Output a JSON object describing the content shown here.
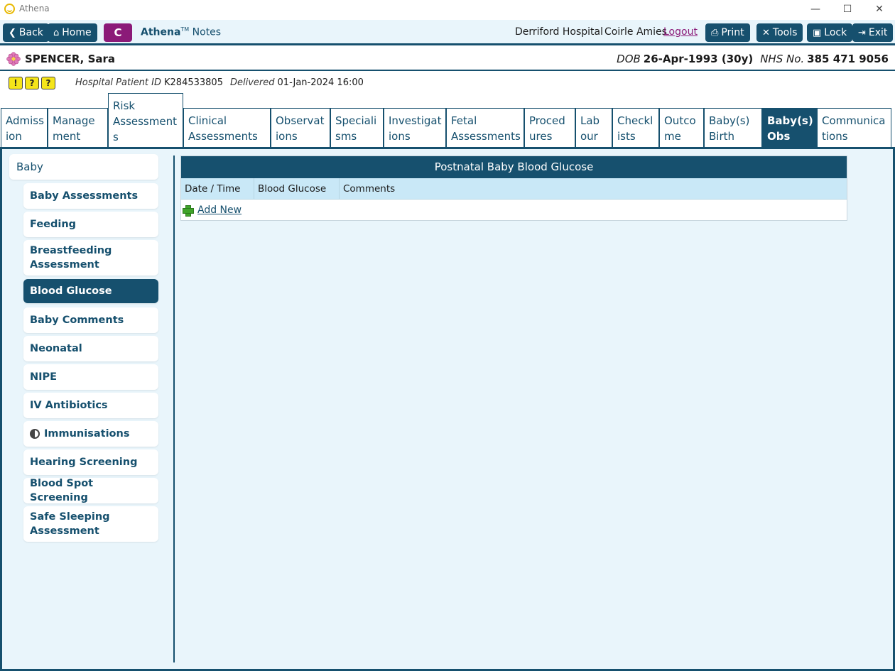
{
  "window": {
    "title": "Athena",
    "controls": [
      "—",
      "☐",
      "✕"
    ]
  },
  "toolbar": {
    "back": "Back",
    "home": "Home",
    "c_badge": "C",
    "app_name": "Athena",
    "app_tm": "TM",
    "app_suffix": "Notes",
    "hospital": "Derriford Hospital",
    "user": "Coirle Amies",
    "logout": "Logout",
    "print": "Print",
    "tools": "Tools",
    "lock": "Lock",
    "exit": "Exit"
  },
  "patient": {
    "name": "SPENCER, Sara",
    "dob_label": "DOB",
    "dob_value": "26-Apr-1993 (30y)",
    "nhs_label": "NHS No.",
    "nhs_value": "385 471 9056"
  },
  "info": {
    "alerts": [
      "!",
      "?",
      "?"
    ],
    "hospital_id_label": "Hospital Patient ID",
    "hospital_id_value": "K284533805",
    "delivered_label": "Delivered",
    "delivered_value": "01-Jan-2024 16:00"
  },
  "tabs": [
    {
      "label": "Admiss ion"
    },
    {
      "label": "Manage ment"
    },
    {
      "label": "Risk Assessment s"
    },
    {
      "label": "Clinical Assessments"
    },
    {
      "label": "Observat ions"
    },
    {
      "label": "Speciali sms"
    },
    {
      "label": "Investigat ions"
    },
    {
      "label": "Fetal Assessments"
    },
    {
      "label": "Proced ures"
    },
    {
      "label": "Lab our"
    },
    {
      "label": "Checkl ists"
    },
    {
      "label": "Outco me"
    },
    {
      "label": "Baby(s) Birth"
    },
    {
      "label": "Baby(s) Obs"
    },
    {
      "label": "Communica tions"
    }
  ],
  "sidebar": {
    "heading": "Baby",
    "items": [
      {
        "label": "Baby Assessments"
      },
      {
        "label": "Feeding"
      },
      {
        "label": "Breastfeeding Assessment"
      },
      {
        "label": "Blood Glucose"
      },
      {
        "label": "Baby Comments"
      },
      {
        "label": "Neonatal"
      },
      {
        "label": "NIPE"
      },
      {
        "label": "IV Antibiotics"
      },
      {
        "label": "Immunisations"
      },
      {
        "label": "Hearing Screening"
      },
      {
        "label": "Blood Spot Screening"
      },
      {
        "label": "Safe Sleeping Assessment"
      }
    ]
  },
  "table": {
    "title": "Postnatal Baby Blood Glucose",
    "columns": [
      "Date / Time",
      "Blood Glucose",
      "Comments"
    ],
    "add_new": "Add New"
  },
  "colors": {
    "primary": "#16506e",
    "accent": "#8b1a78",
    "panel_bg": "#e9f5fb",
    "header_row": "#c9e8f7"
  }
}
